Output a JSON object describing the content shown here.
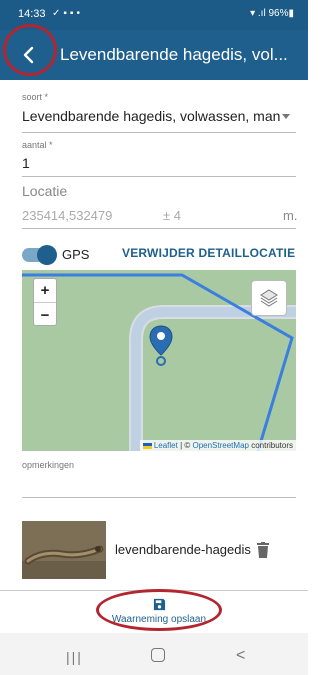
{
  "status_bar": {
    "time": "14:33",
    "battery": "96%"
  },
  "app_bar": {
    "title": "Levendbarende hagedis, vol..."
  },
  "form": {
    "soort": {
      "label": "soort *",
      "value": "Levendbarende hagedis, volwassen, man"
    },
    "aantal": {
      "label": "aantal *",
      "value": "1"
    },
    "locatie": {
      "label": "Locatie",
      "coordinates": "235414,532479",
      "accuracy": "± 4",
      "unit": "m."
    },
    "gps": {
      "label": "GPS",
      "enabled": true
    },
    "delete_location_label": "VERWIJDER DETAILLOCATIE",
    "opmerkingen": {
      "label": "opmerkingen",
      "value": ""
    }
  },
  "map": {
    "zoom_in": "+",
    "zoom_out": "−",
    "attribution": {
      "leaflet": "Leaflet",
      "separator": " | © ",
      "osm": "OpenStreetMap",
      "suffix": " contributors"
    }
  },
  "photo": {
    "filename": "levendbarende-hagedis"
  },
  "save_label": "Waarneming opslaan",
  "colors": {
    "primary": "#1f5f8d",
    "annotation": "#b3252f",
    "map_green": "#a9c9a3"
  }
}
